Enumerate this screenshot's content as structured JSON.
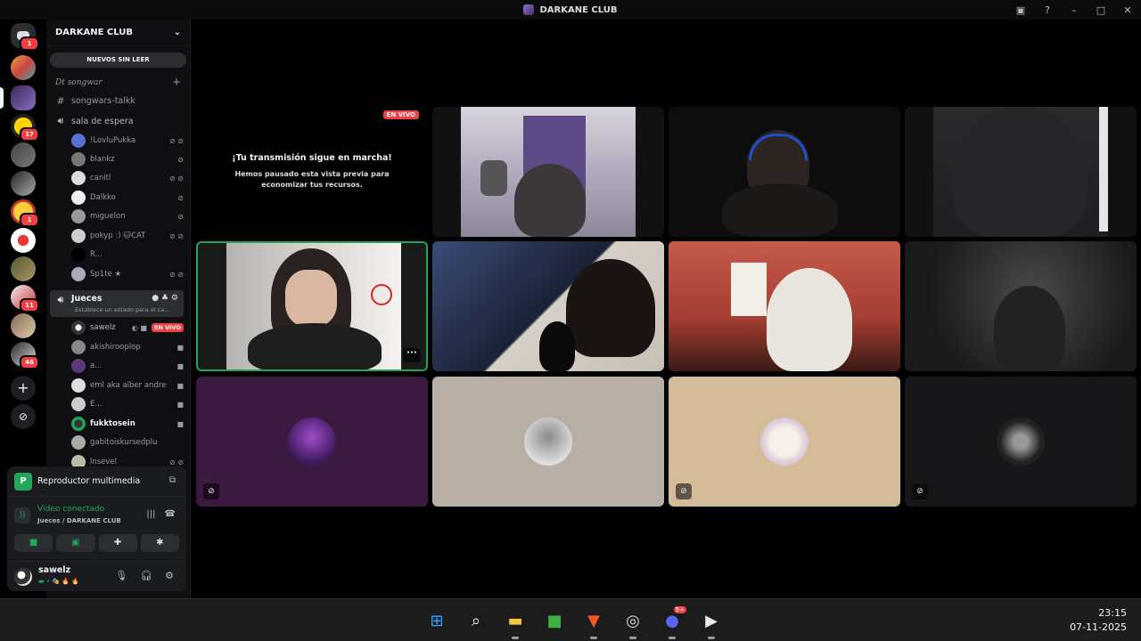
{
  "window": {
    "title": "DARKANE CLUB"
  },
  "server": {
    "name": "DARKANE CLUB",
    "unread_label": "NUEVOS SIN LEER",
    "category": "Dt songwar",
    "badges": [
      "1",
      "17",
      "1",
      "11",
      "46"
    ]
  },
  "channels": {
    "text": "songwars-talkk",
    "waiting_room": "sala de espera",
    "waiting_users": [
      "!LovluPukka",
      "blankz",
      "canitl",
      "Dalkko",
      "miguelon",
      "pokyp :) 🐱CAT",
      "R...",
      "Sp1te ★"
    ],
    "judges": "Jueces",
    "judges_status": "Establece un estado para el ca...",
    "judges_users": [
      "sawelz",
      "akishirooplop",
      "a...",
      "eml aka alber andre",
      "E...",
      "fukktosein",
      "gabitoiskursedplu",
      "lnsevel"
    ],
    "live_badge": "EN VIVO"
  },
  "panel": {
    "media_player": "Reproductor multimedia",
    "media_icon_letter": "P",
    "video_connected": "Vídeo conectado",
    "location": "Jueces / DARKANE CLUB",
    "username": "sawelz",
    "user_status": "▬ • 🎭 🔥 🔥"
  },
  "stream": {
    "live_badge": "EN VIVO",
    "heading": "¡Tu transmisión sigue en marcha!",
    "subtext": "Hemos pausado esta vista previa para economizar tus recursos."
  },
  "tile_menu": "···",
  "taskbar": {
    "time": "23:15",
    "date": "07-11-2025",
    "discord_badge": "9+"
  }
}
